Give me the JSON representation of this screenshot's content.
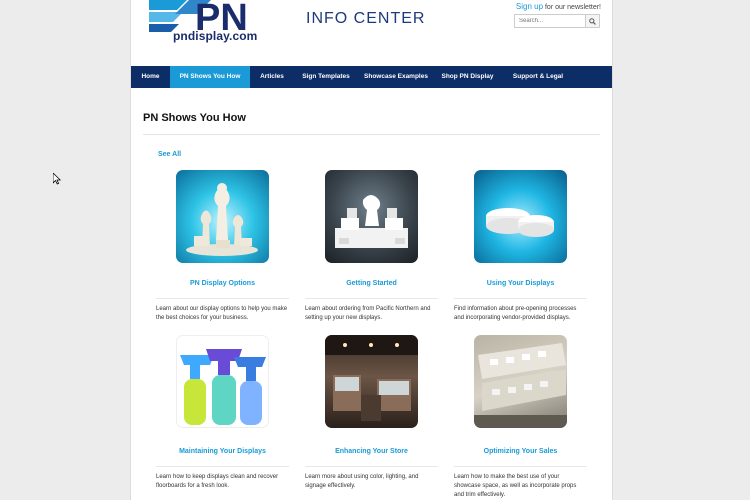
{
  "header": {
    "logo_text": "pndisplay.com",
    "logo_letters": "PN",
    "info_center": "INFO CENTER",
    "newsletter_link": "Sign up",
    "newsletter_text": " for our newsletter!",
    "search_placeholder": "Search..."
  },
  "nav": {
    "items": [
      {
        "label": "Home"
      },
      {
        "label": "PN Shows You How"
      },
      {
        "label": "Articles"
      },
      {
        "label": "Sign Templates"
      },
      {
        "label": "Showcase Examples"
      },
      {
        "label": "Shop PN Display"
      },
      {
        "label": "Support & Legal"
      }
    ],
    "active_index": 1
  },
  "main": {
    "title": "PN Shows You How",
    "see_all": "See All"
  },
  "cards": [
    {
      "title": "PN Display Options",
      "desc": "Learn about our display options to help you make the best choices for your business."
    },
    {
      "title": "Getting Started",
      "desc": "Learn about ordering from Pacific Northern and setting up your new displays."
    },
    {
      "title": "Using Your Displays",
      "desc": "Find information about pre-opening processes and incorporating vendor-provided displays."
    },
    {
      "title": "Maintaining Your Displays",
      "desc": "Learn how to keep displays clean and recover floorboards for a fresh look."
    },
    {
      "title": "Enhancing Your Store",
      "desc": "Learn more about using color, lighting, and signage effectively."
    },
    {
      "title": "Optimizing Your Sales",
      "desc": "Learn how to make the best use of your showcase space, as well as incorporate props and trim effectively."
    }
  ],
  "colors": {
    "nav_bg": "#0d2d66",
    "nav_active": "#1a9ad6",
    "link": "#1a9ad6",
    "brand_navy": "#1a2c6b"
  }
}
